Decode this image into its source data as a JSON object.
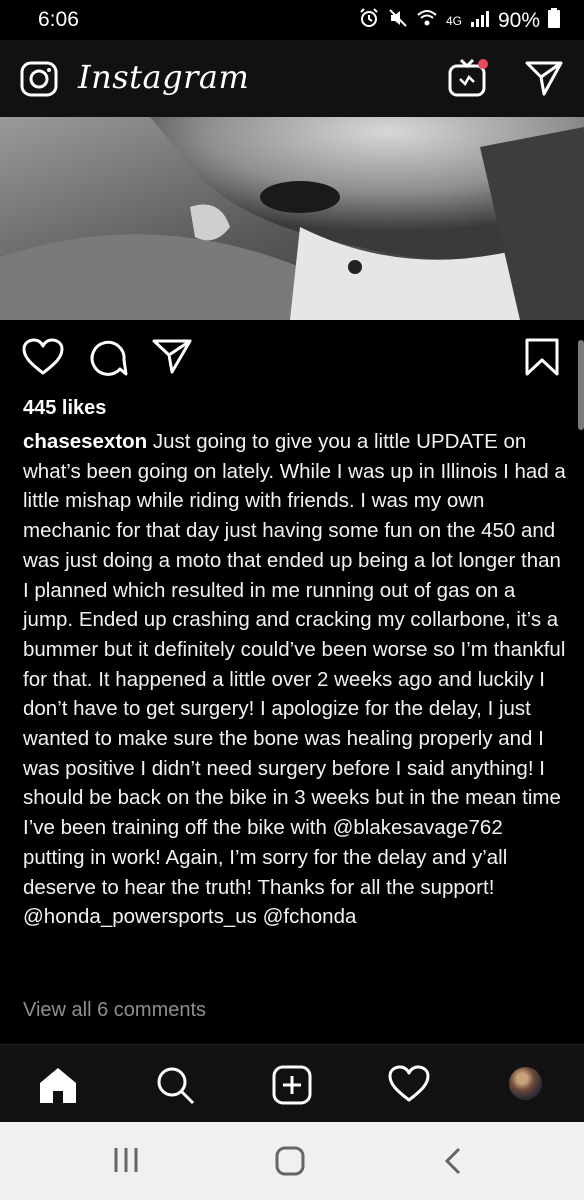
{
  "status_bar": {
    "time": "6:06",
    "network": "4G",
    "battery": "90%"
  },
  "header": {
    "app_name": "Instagram"
  },
  "post": {
    "likes": "445 likes",
    "username": "chasesexton",
    "caption": " Just going to give you a little UPDATE on what’s been going on lately. While I was up in Illinois I had a little mishap while riding with friends. I was my own mechanic for that day just having some fun on the 450 and was just doing a moto that ended up being a lot longer than I planned which resulted in me running out of gas on a jump. Ended up crashing and cracking my collarbone, it’s a bummer but it definitely could’ve been worse so I’m thankful for that. It happened a little over 2 weeks ago and luckily I don’t have to get surgery! I apologize for the delay, I just wanted to make sure the bone was healing properly and I was positive I didn’t need surgery before I said anything! I should be back on the bike in 3 weeks but in the mean time I’ve been training off the bike with @blakesavage762 putting in work! Again, I’m sorry for the delay and y’all deserve to hear the truth! Thanks for all the support! @honda_powersports_us @fchonda",
    "view_comments": "View all 6 comments"
  },
  "icons": {
    "camera": "camera-icon",
    "igtv": "igtv-icon",
    "direct": "direct-message-icon",
    "like": "heart-icon",
    "comment": "comment-icon",
    "share": "send-icon",
    "save": "bookmark-icon",
    "home": "home-icon",
    "search": "search-icon",
    "add": "add-post-icon",
    "activity": "heart-icon",
    "profile": "profile-avatar"
  },
  "colors": {
    "background": "#000000",
    "notification_dot": "#ed4956",
    "muted_text": "#8e8e8e"
  }
}
